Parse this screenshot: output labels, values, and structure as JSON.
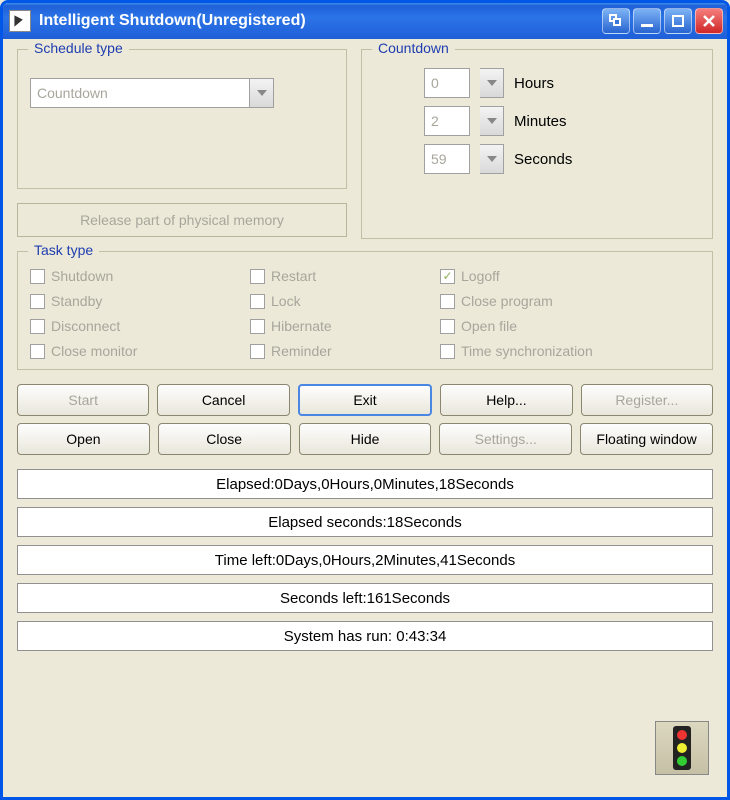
{
  "titlebar": {
    "title": "Intelligent Shutdown(Unregistered)"
  },
  "schedule": {
    "legend": "Schedule type",
    "value": "Countdown"
  },
  "memory_button": "Release part of physical memory",
  "countdown": {
    "legend": "Countdown",
    "hours_value": "0",
    "hours_label": "Hours",
    "minutes_value": "2",
    "minutes_label": "Minutes",
    "seconds_value": "59",
    "seconds_label": "Seconds"
  },
  "tasktype": {
    "legend": "Task type",
    "items": [
      {
        "label": "Shutdown",
        "checked": false
      },
      {
        "label": "Restart",
        "checked": false
      },
      {
        "label": "Logoff",
        "checked": true
      },
      {
        "label": "Standby",
        "checked": false
      },
      {
        "label": "Lock",
        "checked": false
      },
      {
        "label": "Close program",
        "checked": false
      },
      {
        "label": "Disconnect",
        "checked": false
      },
      {
        "label": "Hibernate",
        "checked": false
      },
      {
        "label": "Open file",
        "checked": false
      },
      {
        "label": "Close monitor",
        "checked": false
      },
      {
        "label": "Reminder",
        "checked": false
      },
      {
        "label": "Time synchronization",
        "checked": false
      }
    ]
  },
  "buttons": {
    "row1": {
      "start": "Start",
      "cancel": "Cancel",
      "exit": "Exit",
      "help": "Help...",
      "register": "Register..."
    },
    "row2": {
      "open": "Open",
      "close": "Close",
      "hide": "Hide",
      "settings": "Settings...",
      "floating": "Floating window"
    }
  },
  "status": {
    "elapsed": "Elapsed:0Days,0Hours,0Minutes,18Seconds",
    "elapsed_seconds": "Elapsed seconds:18Seconds",
    "time_left": "Time left:0Days,0Hours,2Minutes,41Seconds",
    "seconds_left": "Seconds left:161Seconds",
    "system_run": "System has run: 0:43:34"
  }
}
